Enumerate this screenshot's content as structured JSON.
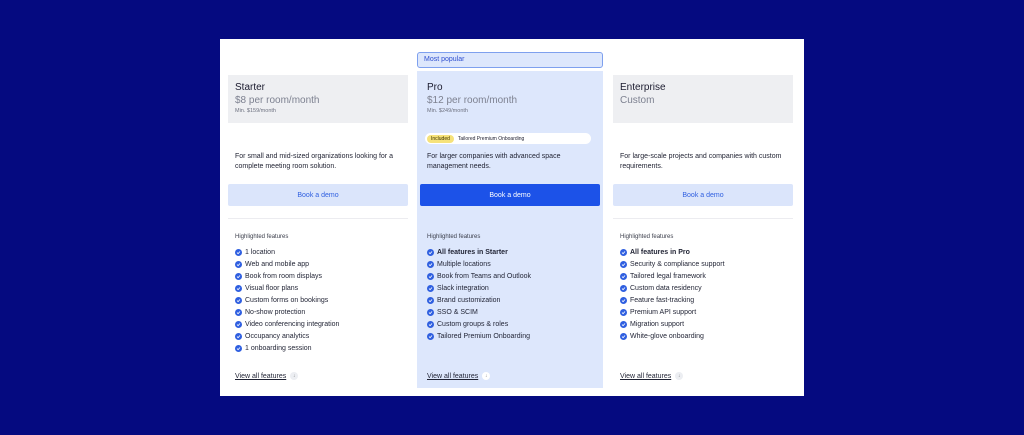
{
  "popular_label": "Most popular",
  "plans": [
    {
      "name": "Starter",
      "price": "$8 per room/month",
      "min": "Min. $159/month",
      "description": "For small and mid-sized organizations looking for a complete meeting room solution.",
      "cta": "Book a demo",
      "highlight_label": "Highlighted features",
      "features": [
        "1 location",
        "Web and mobile app",
        "Book from room displays",
        "Visual floor plans",
        "Custom forms on bookings",
        "No-show protection",
        "Video conferencing integration",
        "Occupancy analytics",
        "1 onboarding session"
      ],
      "view_all": "View all features"
    },
    {
      "name": "Pro",
      "price": "$12 per room/month",
      "min": "Min. $249/month",
      "included_tag": "Included",
      "included_text": "Tailored Premium Onboarding",
      "description": "For larger companies with advanced space management needs.",
      "cta": "Book a demo",
      "highlight_label": "Highlighted features",
      "features": [
        "All features in Starter",
        "Multiple locations",
        "Book from Teams and Outlook",
        "Slack integration",
        "Brand customization",
        "SSO & SCIM",
        "Custom groups & roles",
        "Tailored Premium Onboarding"
      ],
      "view_all": "View all features"
    },
    {
      "name": "Enterprise",
      "price": "Custom",
      "description": "For large-scale projects and companies with custom requirements.",
      "cta": "Book a demo",
      "highlight_label": "Highlighted features",
      "features": [
        "All features in Pro",
        "Security & compliance support",
        "Tailored legal framework",
        "Custom data residency",
        "Feature fast-tracking",
        "Premium API support",
        "Migration support",
        "White-glove onboarding"
      ],
      "view_all": "View all features"
    }
  ],
  "colors": {
    "background": "#050a80",
    "accent": "#1c52e8",
    "pro_tint": "#dde7fc",
    "included_tag": "#f6e27a"
  }
}
